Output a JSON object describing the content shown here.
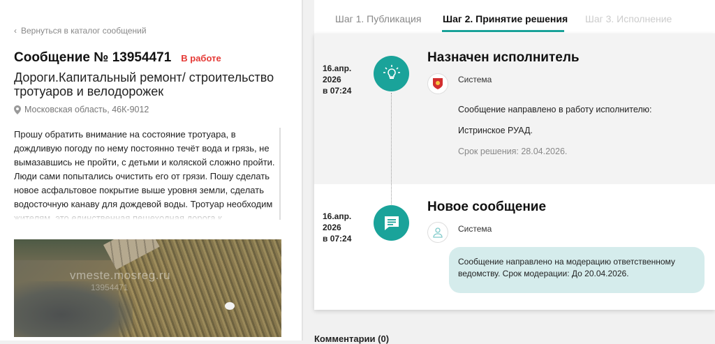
{
  "left": {
    "back_link": "Вернуться в каталог сообщений",
    "title": "Сообщение № 13954471",
    "status": "В работе",
    "category": "Дороги.Капитальный ремонт/ строительство тротуаров и велодорожек",
    "location": "Московская область, 46К-9012",
    "body": "Прошу обратить внимание на состояние тротуара, в дождливую погоду по нему постоянно течёт вода и грязь, не вымазавшись не пройти, с детьми и коляской сложно пройти. Люди сами попытались очистить его от грязи. Пошу сделать новое асфальтовое покрытие выше уровня земли, сделать водосточную канаву для дождевой воды. Тротуар необходим жителям, это единственная пешеходная дорога к",
    "photo_watermark": "vmeste.mosreg.ru",
    "photo_watermark_sub": "13954471"
  },
  "tabs": [
    {
      "label": "Шаг 1. Публикация"
    },
    {
      "label": "Шаг 2. Принятие решения"
    },
    {
      "label": "Шаг 3. Исполнение"
    }
  ],
  "events": [
    {
      "date_line1": "16.апр.",
      "date_line2": "2026",
      "date_line3": "в 07:24",
      "title": "Назначен исполнитель",
      "author": "Система",
      "line1": "Сообщение направлено в работу исполнителю:",
      "line2": "Истринское РУАД.",
      "line3": "Срок решения: 28.04.2026."
    },
    {
      "date_line1": "16.апр.",
      "date_line2": "2026",
      "date_line3": "в 07:24",
      "title": "Новое сообщение",
      "author": "Система",
      "bubble": "Сообщение направлено на модерацию ответственному ведомству. Срок модерации: До 20.04.2026."
    }
  ],
  "comments_label": "Комментарии (0)",
  "colors": {
    "accent": "#1aa39a",
    "status": "#e53935",
    "bubble": "#d5ecec"
  }
}
